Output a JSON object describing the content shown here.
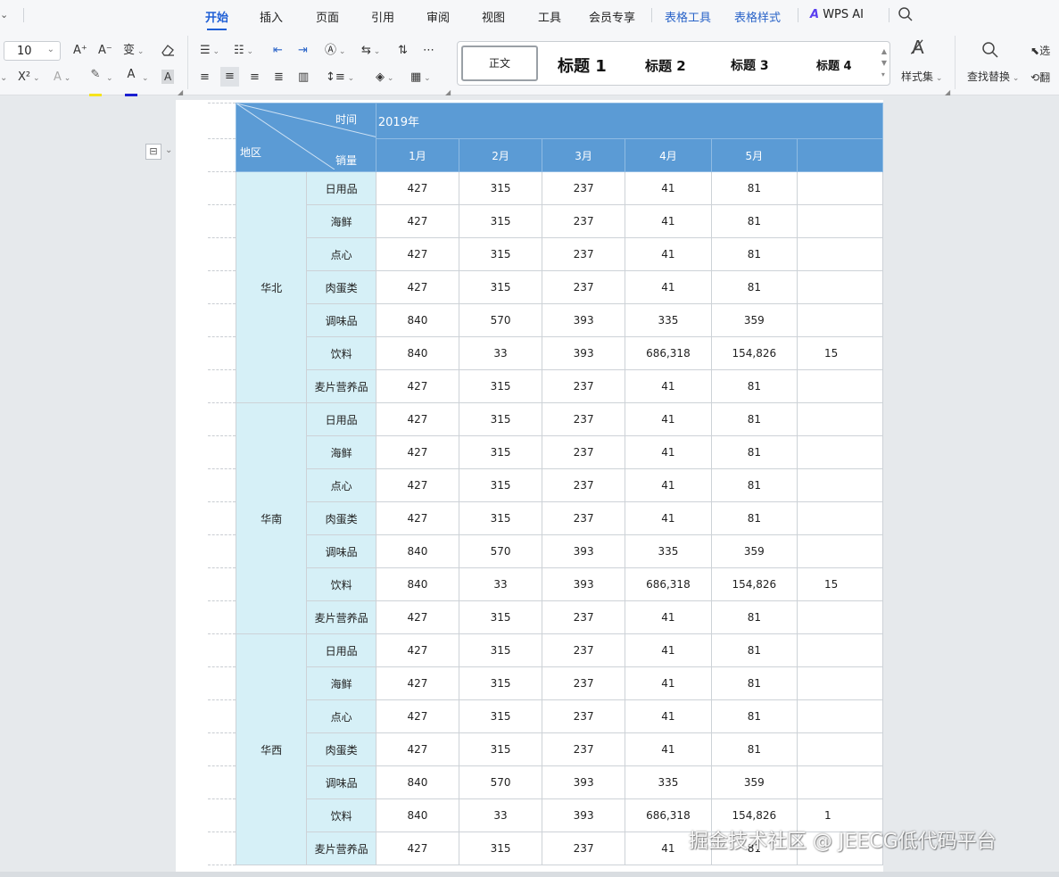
{
  "menubar": {
    "tabs": [
      {
        "label": "开始",
        "active": true
      },
      {
        "label": "插入"
      },
      {
        "label": "页面"
      },
      {
        "label": "引用"
      },
      {
        "label": "审阅"
      },
      {
        "label": "视图"
      },
      {
        "label": "工具"
      },
      {
        "label": "会员专享"
      }
    ],
    "context_tabs": [
      "表格工具",
      "表格样式"
    ],
    "wps_ai": "WPS AI"
  },
  "toolbar": {
    "font_size": "10",
    "grow_font": "A⁺",
    "shrink_font": "A⁻",
    "phonetic": "变",
    "superscript": "X²",
    "text_effect": "A",
    "font_color": "A",
    "char_shade": "A",
    "styles": {
      "normal": "正文",
      "h1": "标题 1",
      "h2": "标题 2",
      "h3": "标题 3",
      "h4": "标题 4"
    },
    "style_set": "样式集",
    "find_replace": "查找替换",
    "select_partial": "选",
    "translate_partial": "翻"
  },
  "table": {
    "header": {
      "time_label": "时间",
      "sales_label": "销量",
      "region_label": "地区",
      "year": "2019年",
      "months": [
        "1月",
        "2月",
        "3月",
        "4月",
        "5月"
      ]
    },
    "groups": [
      {
        "region": "华北",
        "rows": [
          {
            "cat": "日用品",
            "v": [
              "427",
              "315",
              "237",
              "41",
              "81"
            ],
            "cut": ""
          },
          {
            "cat": "海鲜",
            "v": [
              "427",
              "315",
              "237",
              "41",
              "81"
            ],
            "cut": ""
          },
          {
            "cat": "点心",
            "v": [
              "427",
              "315",
              "237",
              "41",
              "81"
            ],
            "cut": ""
          },
          {
            "cat": "肉蛋类",
            "v": [
              "427",
              "315",
              "237",
              "41",
              "81"
            ],
            "cut": ""
          },
          {
            "cat": "调味品",
            "v": [
              "840",
              "570",
              "393",
              "335",
              "359"
            ],
            "cut": ""
          },
          {
            "cat": "饮料",
            "v": [
              "840",
              "33",
              "393",
              "686,318",
              "154,826"
            ],
            "cut": "15"
          },
          {
            "cat": "麦片营养品",
            "v": [
              "427",
              "315",
              "237",
              "41",
              "81"
            ],
            "cut": ""
          }
        ]
      },
      {
        "region": "华南",
        "rows": [
          {
            "cat": "日用品",
            "v": [
              "427",
              "315",
              "237",
              "41",
              "81"
            ],
            "cut": ""
          },
          {
            "cat": "海鲜",
            "v": [
              "427",
              "315",
              "237",
              "41",
              "81"
            ],
            "cut": ""
          },
          {
            "cat": "点心",
            "v": [
              "427",
              "315",
              "237",
              "41",
              "81"
            ],
            "cut": ""
          },
          {
            "cat": "肉蛋类",
            "v": [
              "427",
              "315",
              "237",
              "41",
              "81"
            ],
            "cut": ""
          },
          {
            "cat": "调味品",
            "v": [
              "840",
              "570",
              "393",
              "335",
              "359"
            ],
            "cut": ""
          },
          {
            "cat": "饮料",
            "v": [
              "840",
              "33",
              "393",
              "686,318",
              "154,826"
            ],
            "cut": "15"
          },
          {
            "cat": "麦片营养品",
            "v": [
              "427",
              "315",
              "237",
              "41",
              "81"
            ],
            "cut": ""
          }
        ]
      },
      {
        "region": "华西",
        "rows": [
          {
            "cat": "日用品",
            "v": [
              "427",
              "315",
              "237",
              "41",
              "81"
            ],
            "cut": ""
          },
          {
            "cat": "海鲜",
            "v": [
              "427",
              "315",
              "237",
              "41",
              "81"
            ],
            "cut": ""
          },
          {
            "cat": "点心",
            "v": [
              "427",
              "315",
              "237",
              "41",
              "81"
            ],
            "cut": ""
          },
          {
            "cat": "肉蛋类",
            "v": [
              "427",
              "315",
              "237",
              "41",
              "81"
            ],
            "cut": ""
          },
          {
            "cat": "调味品",
            "v": [
              "840",
              "570",
              "393",
              "335",
              "359"
            ],
            "cut": ""
          },
          {
            "cat": "饮料",
            "v": [
              "840",
              "33",
              "393",
              "686,318",
              "154,826"
            ],
            "cut": "1"
          },
          {
            "cat": "麦片营养品",
            "v": [
              "427",
              "315",
              "237",
              "41",
              "81"
            ],
            "cut": ""
          }
        ]
      }
    ]
  },
  "watermark": "掘金技术社区 @ JEECG低代码平台",
  "colors": {
    "header_blue": "#5b9bd5",
    "region_cyan": "#d6f0f7",
    "active_tab": "#1f5fd6"
  }
}
